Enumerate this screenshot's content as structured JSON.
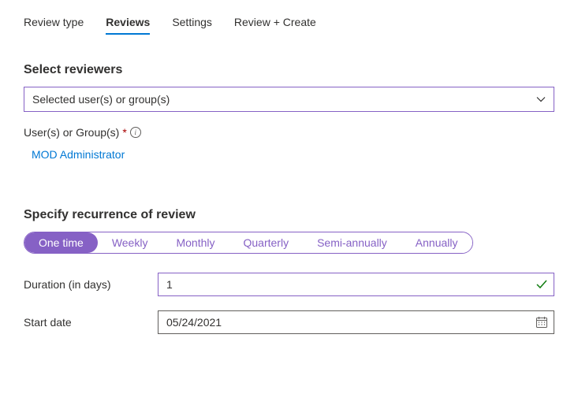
{
  "tabs": {
    "review_type": "Review type",
    "reviews": "Reviews",
    "settings": "Settings",
    "review_create": "Review + Create"
  },
  "reviewers": {
    "section_title": "Select reviewers",
    "dropdown_value": "Selected user(s) or group(s)",
    "users_label": "User(s) or Group(s)",
    "required_mark": "*",
    "selected_user": "MOD Administrator"
  },
  "recurrence": {
    "section_title": "Specify recurrence of review",
    "options": {
      "one_time": "One time",
      "weekly": "Weekly",
      "monthly": "Monthly",
      "quarterly": "Quarterly",
      "semi_annually": "Semi-annually",
      "annually": "Annually"
    },
    "duration_label": "Duration (in days)",
    "duration_value": "1",
    "start_date_label": "Start date",
    "start_date_value": "05/24/2021"
  }
}
